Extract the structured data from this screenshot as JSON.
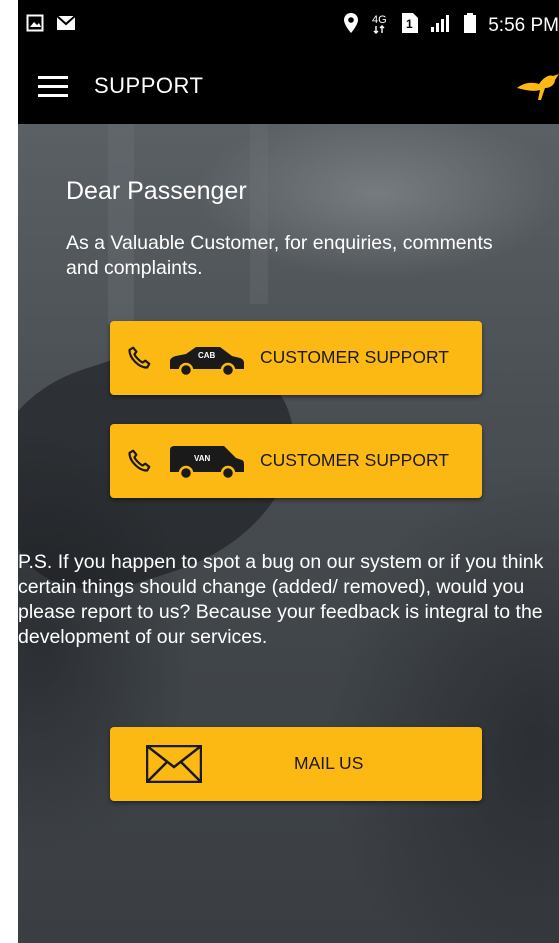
{
  "status_bar": {
    "network": "4G",
    "sim_slot": "1",
    "time": "5:56 PM",
    "icons": [
      "image-icon",
      "mail-icon",
      "location-pin-icon",
      "network-4g-icon",
      "sim-icon",
      "signal-icon",
      "battery-icon"
    ]
  },
  "app_bar": {
    "title": "SUPPORT",
    "logo": "kangaroo-logo-icon"
  },
  "content": {
    "greeting": "Dear Passenger",
    "intro": "As a Valuable Customer, for enquiries, comments and complaints.",
    "buttons": [
      {
        "label": "CUSTOMER SUPPORT",
        "vehicle_text": "CAB",
        "icon": "cab-icon"
      },
      {
        "label": "CUSTOMER SUPPORT",
        "vehicle_text": "VAN",
        "icon": "van-icon"
      }
    ],
    "ps": "P.S. If you happen to spot a bug on our system or if you think certain things should change (added/ removed), would you please report to us? Because your feedback is integral to the development of our services.",
    "mail_button": {
      "label": "MAIL US",
      "icon": "envelope-icon"
    }
  },
  "colors": {
    "accent": "#FDB913",
    "bar_background": "#000000"
  }
}
